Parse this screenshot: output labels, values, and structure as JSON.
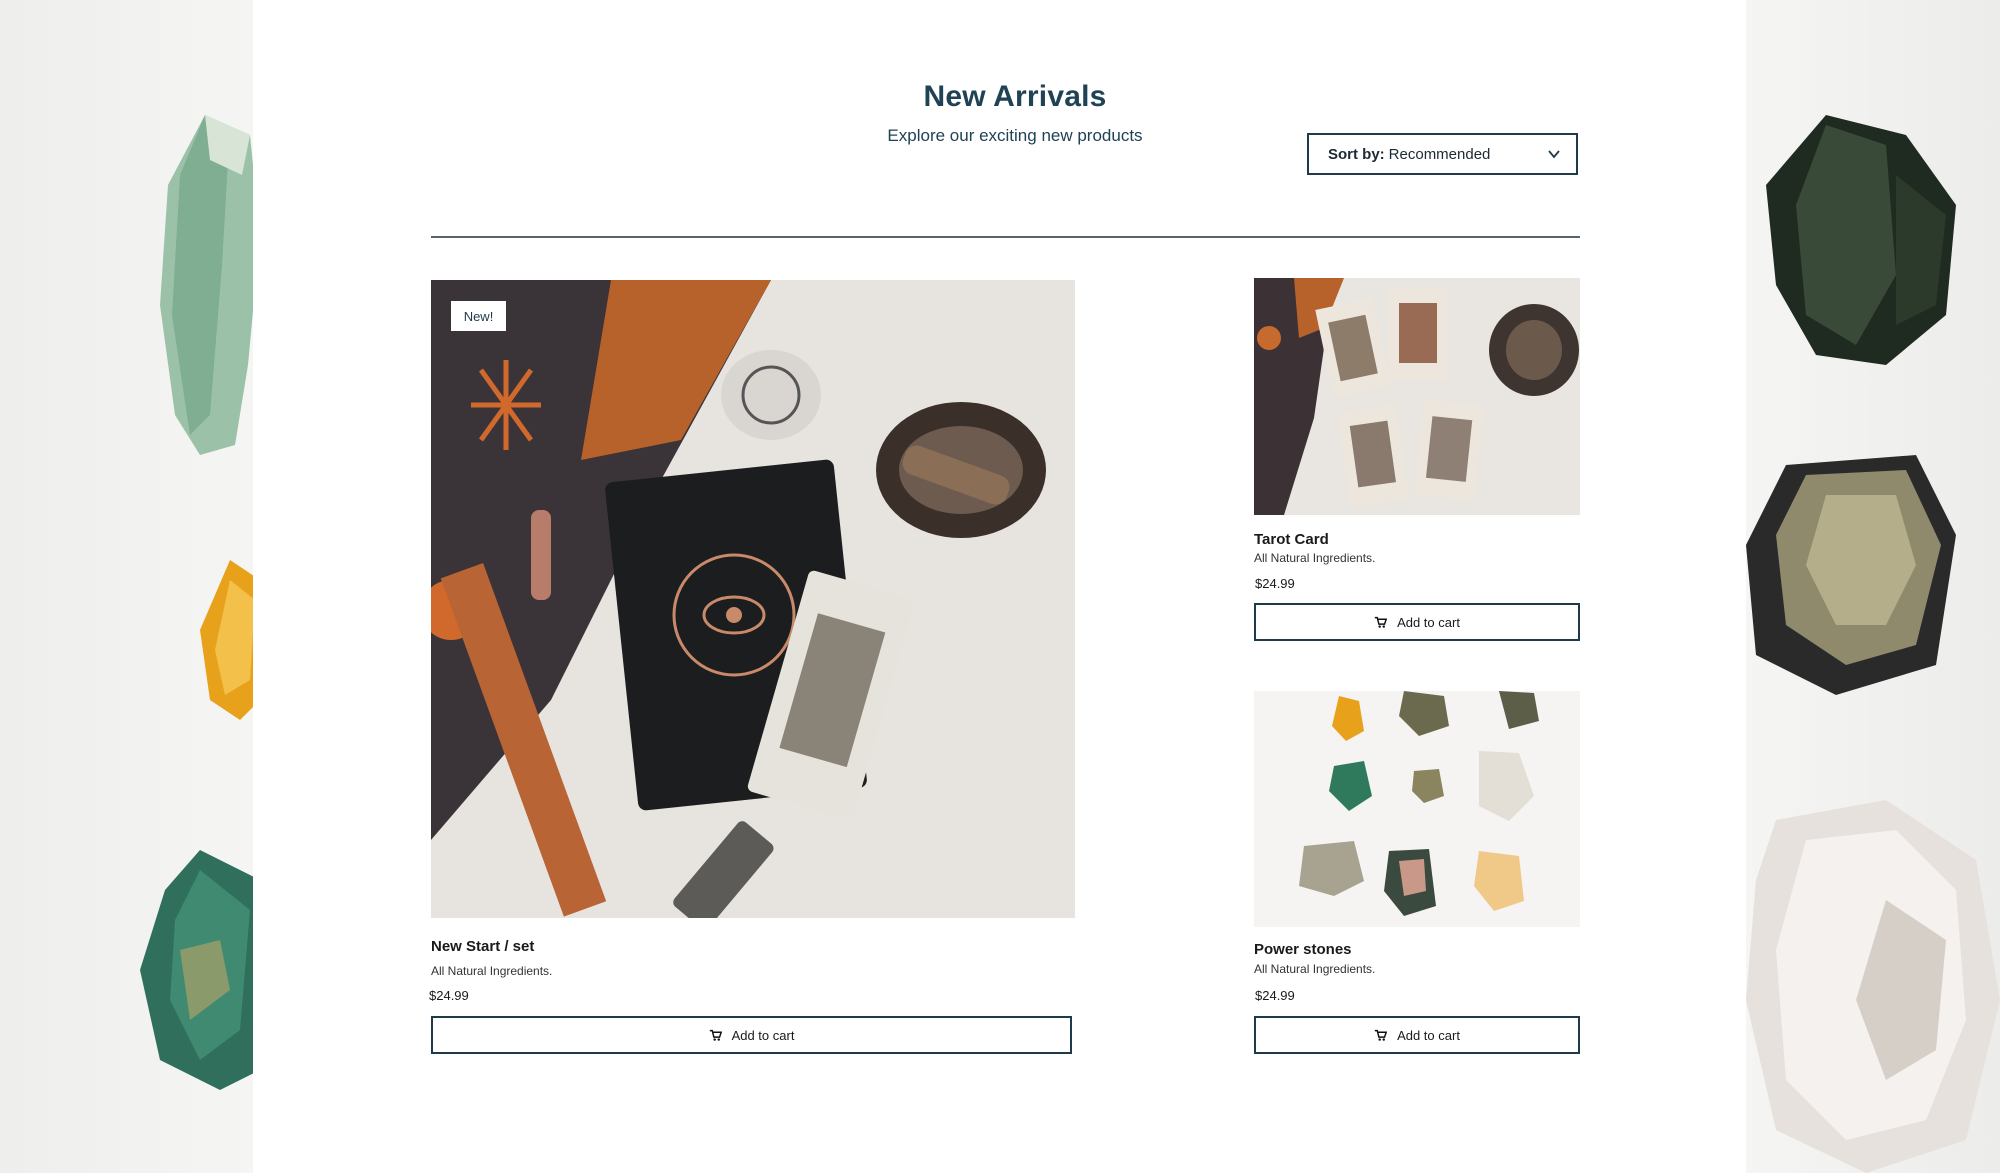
{
  "header": {
    "title": "New Arrivals",
    "subtitle": "Explore our exciting new products"
  },
  "sort": {
    "label": "Sort by:",
    "value": "Recommended"
  },
  "products": [
    {
      "badge": "New!",
      "name": "New Start / set",
      "description": "All Natural Ingredients.",
      "price": "$24.99",
      "cart_label": "Add to cart"
    },
    {
      "name": "Tarot Card",
      "description": "All Natural Ingredients.",
      "price": "$24.99",
      "cart_label": "Add to cart"
    },
    {
      "name": "Power stones",
      "description": "All Natural Ingredients.",
      "price": "$24.99",
      "cart_label": "Add to cart"
    }
  ],
  "colors": {
    "text_primary": "#1f4255",
    "border": "#1f3a4a",
    "background": "#ffffff"
  },
  "icons": {
    "sort_chevron": "chevron-down-icon",
    "cart": "cart-icon"
  }
}
